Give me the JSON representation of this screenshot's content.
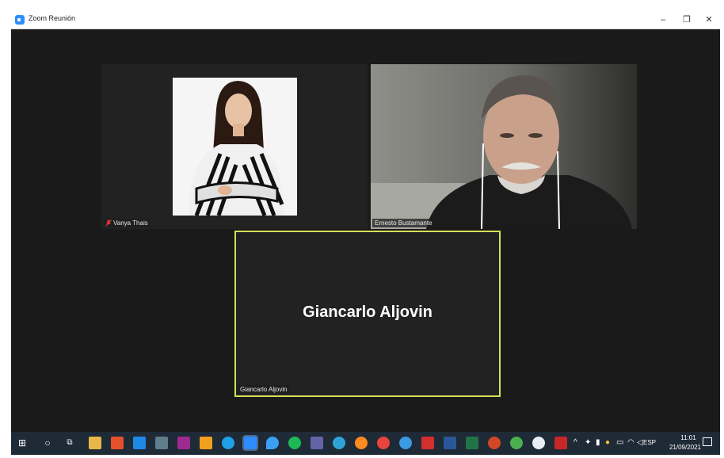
{
  "window": {
    "title": "Zoom Reunión",
    "minimize": "–",
    "maximize": "❐",
    "close": "✕"
  },
  "participants": [
    {
      "name": "Vanya Thais",
      "muted": true,
      "video": true
    },
    {
      "name": "Ernesto Bustamante",
      "muted": false,
      "video": true
    },
    {
      "name": "Giancarlo Aljovin",
      "muted": false,
      "video": false,
      "display_name": "Giancarlo Aljovin"
    }
  ],
  "taskbar": {
    "language": "ESP",
    "time": "11:01",
    "date": "21/09/2021"
  },
  "colors": {
    "active_speaker_border": "#d4e157",
    "taskbar": "#1f2a37",
    "meeting_bg": "#1a1a1a"
  }
}
